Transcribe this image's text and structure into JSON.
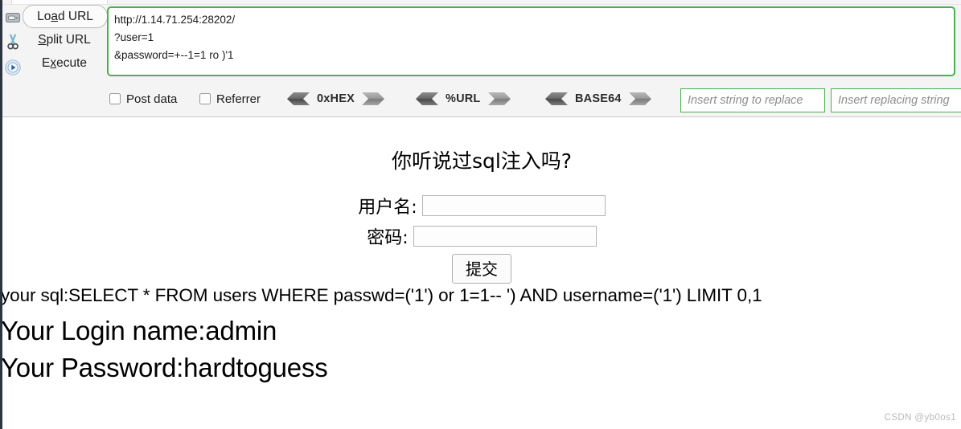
{
  "hackbar": {
    "icons": [
      "load-url-icon",
      "split-url-icon",
      "execute-icon"
    ],
    "actions": [
      {
        "name": "load-url",
        "prefix": "Lo",
        "accel": "a",
        "suffix": "d URL"
      },
      {
        "name": "split-url",
        "prefix": "",
        "accel": "S",
        "suffix": "plit URL"
      },
      {
        "name": "execute",
        "prefix": "E",
        "accel": "x",
        "suffix": "ecute"
      }
    ],
    "url_lines": [
      "http://1.14.71.254:28202/",
      "?user=1",
      "&password=+--1=1 ro )'1"
    ],
    "url_border_color": "#4caf50",
    "checkboxes": [
      {
        "label": "Post data",
        "checked": false
      },
      {
        "label": "Referrer",
        "checked": false
      }
    ],
    "encoders": [
      {
        "label": "0xHEX"
      },
      {
        "label": "%URL"
      },
      {
        "label": "BASE64"
      }
    ],
    "replace_inputs": [
      {
        "placeholder": "Insert string to replace",
        "value": ""
      },
      {
        "placeholder": "Insert replacing string",
        "value": ""
      }
    ]
  },
  "page": {
    "title": "你听说过sql注入吗?",
    "form": {
      "username_label": "用户名:",
      "username_value": "",
      "password_label": "密码:",
      "password_value": "",
      "submit_label": "提交"
    },
    "sql_line": "your sql:SELECT * FROM users WHERE passwd=('1') or 1=1-- ') AND username=('1') LIMIT 0,1",
    "login_line": "Your Login name:admin",
    "password_line": "Your Password:hardtoguess"
  },
  "watermark": "CSDN @yb0os1"
}
